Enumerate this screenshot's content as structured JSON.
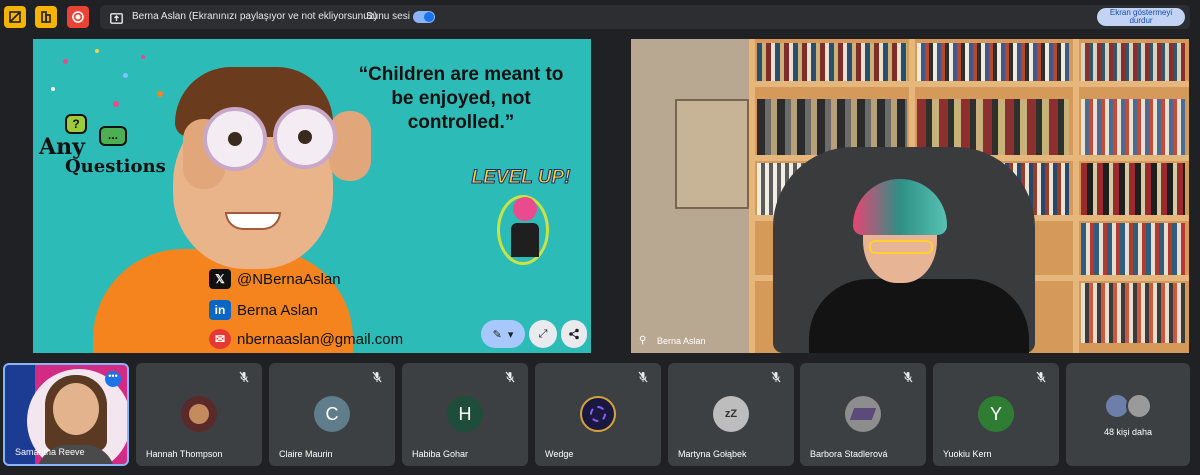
{
  "topbar": {
    "share_status": "Berna Aslan (Ekranınızı paylaşıyor ve not ekliyorsunuz)",
    "audio_label": "Sunu sesi",
    "audio_on": true,
    "stop_label_1": "Ekran göstermeyi",
    "stop_label_2": "durdur"
  },
  "slide": {
    "quote": "“Children are meant to be enjoyed, not controlled.”",
    "any": "Any",
    "questions": "Questions",
    "bubble_q": "?",
    "bubble_dots": "...",
    "level_up": "LEVEL UP!",
    "twitter": "@NBernaAslan",
    "linkedin": "Berna Aslan",
    "email": "nbernaaslan@gmail.com",
    "icons": [
      "x-logo-icon",
      "linkedin-icon",
      "mail-icon",
      "pen-icon",
      "chevron-down-icon",
      "expand-icon",
      "share-icon"
    ]
  },
  "camera": {
    "name": "Berna Aslan"
  },
  "participants": [
    {
      "name": "Samantha Reeve",
      "self": true
    },
    {
      "name": "Hannah Thompson",
      "initial": "",
      "color": "#3c4043"
    },
    {
      "name": "Claire Maurin",
      "initial": "C",
      "color": "#607d8b"
    },
    {
      "name": "Habiba Gohar",
      "initial": "H",
      "color": "#1e4d3b"
    },
    {
      "name": "Wedge",
      "initial": "",
      "color": "#2d2a6b"
    },
    {
      "name": "Martyna Gołąbek",
      "initial": "",
      "color": "#bdbdbd"
    },
    {
      "name": "Barbora Stadlerová",
      "initial": "",
      "color": "#8d8d8d"
    },
    {
      "name": "Yuokiu Kern",
      "initial": "Y",
      "color": "#2e7d32"
    }
  ],
  "more": {
    "label": "48 kişi daha"
  },
  "colors": {
    "accent": "#8ab4f8",
    "background": "#202124",
    "tile": "#3c4043"
  }
}
